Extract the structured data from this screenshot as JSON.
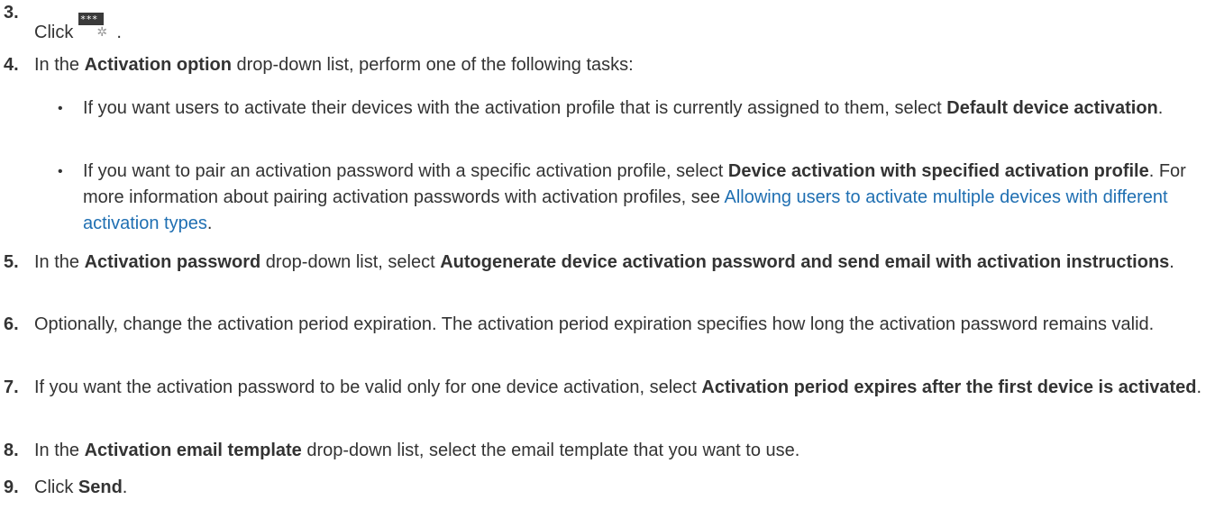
{
  "steps": [
    {
      "num": "3.",
      "text_before": "Click",
      "icon": "activation-settings-icon",
      "text_after": "."
    },
    {
      "num": "4.",
      "pre": "In the ",
      "b1": "Activation option",
      "post": " drop-down list, perform one of the following tasks:"
    },
    {
      "num": "5.",
      "pre": "In the ",
      "b1": "Activation password",
      "mid": " drop-down list, select ",
      "b2": "Autogenerate device activation password and send email with activation instructions",
      "post": "."
    },
    {
      "num": "6.",
      "text": "Optionally, change the activation period expiration. The activation period expiration specifies how long the activation password remains valid."
    },
    {
      "num": "7.",
      "pre": "If you want the activation password to be valid only for one device activation, select ",
      "b1": "Activation period expires after the first device is activated",
      "post": "."
    },
    {
      "num": "8.",
      "pre": "In the ",
      "b1": "Activation email template",
      "post": " drop-down list, select the email template that you want to use."
    },
    {
      "num": "9.",
      "pre": "Click ",
      "b1": "Send",
      "post": "."
    }
  ],
  "bullets": [
    {
      "dot": "•",
      "pre": "If you want users to activate their devices with the activation profile that is currently assigned to them, select ",
      "b1": "Default device activation",
      "post": "."
    },
    {
      "dot": "•",
      "pre": "If you want to pair an activation password with a specific activation profile, select ",
      "b1": "Device activation with specified activation profile",
      "mid": ". For more information about pairing activation passwords with activation profiles, see ",
      "link": "Allowing users to activate multiple devices with different activation types",
      "post": "."
    }
  ]
}
